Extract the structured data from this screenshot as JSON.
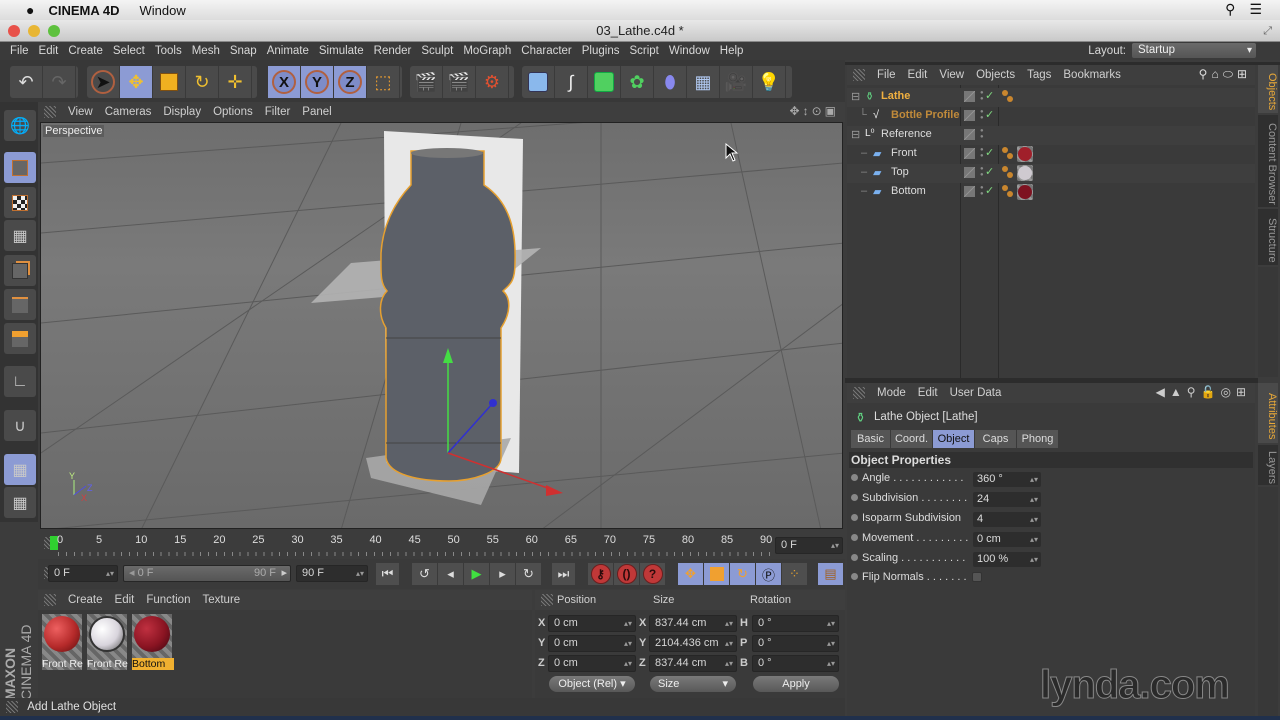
{
  "os_menubar": {
    "app_name": "CINEMA 4D",
    "menu": "Window",
    "apple_icon": "apple-icon",
    "search_icon": "search-icon",
    "list_icon": "list-icon"
  },
  "window": {
    "title": "03_Lathe.c4d *"
  },
  "menu": [
    "File",
    "Edit",
    "Create",
    "Select",
    "Tools",
    "Mesh",
    "Snap",
    "Animate",
    "Simulate",
    "Render",
    "Sculpt",
    "MoGraph",
    "Character",
    "Plugins",
    "Script",
    "Window",
    "Help"
  ],
  "layout": {
    "label": "Layout:",
    "value": "Startup"
  },
  "toolbar": {
    "undo": "undo-icon",
    "redo": "redo-icon",
    "tools": [
      "live-selection",
      "move",
      "scale",
      "rotate",
      "recent-tool"
    ],
    "axes": [
      "X",
      "Y",
      "Z"
    ],
    "coord_system": "world-coordinates",
    "render": [
      "render-view",
      "render-picture-viewer",
      "edit-render-settings"
    ],
    "create": [
      "cube",
      "pen-spline",
      "subdivision-surface",
      "array",
      "deformer",
      "floor",
      "camera",
      "light"
    ]
  },
  "viewport_menu": [
    "View",
    "Cameras",
    "Display",
    "Options",
    "Filter",
    "Panel"
  ],
  "viewport": {
    "label": "Perspective",
    "axis_x": "X",
    "axis_y": "Y",
    "axis_z": "Z"
  },
  "timeline": {
    "ticks": [
      "0",
      "5",
      "10",
      "15",
      "20",
      "25",
      "30",
      "35",
      "40",
      "45",
      "50",
      "55",
      "60",
      "65",
      "70",
      "75",
      "80",
      "85",
      "90"
    ],
    "current_frame": "0 F",
    "start": "0 F",
    "range_start": "0 F",
    "range_end": "90 F",
    "end": "90 F"
  },
  "material_menu": [
    "Create",
    "Edit",
    "Function",
    "Texture"
  ],
  "materials": [
    {
      "name": "Front Re",
      "color": "#b52a2a",
      "selected": false
    },
    {
      "name": "Front Re",
      "color": "#d8d4dc",
      "selected": false
    },
    {
      "name": "Bottom",
      "color": "#8a1422",
      "selected": true
    }
  ],
  "branding": {
    "maxon": "MAXON",
    "c4d": "CINEMA 4D",
    "lynda": "lynda.com"
  },
  "coordinates": {
    "headers": [
      "Position",
      "Size",
      "Rotation"
    ],
    "rows": [
      {
        "pos_label": "X",
        "pos": "0 cm",
        "size_label": "X",
        "size": "837.44 cm",
        "rot_label": "H",
        "rot": "0 °"
      },
      {
        "pos_label": "Y",
        "pos": "0 cm",
        "size_label": "Y",
        "size": "2104.436 cm",
        "rot_label": "P",
        "rot": "0 °"
      },
      {
        "pos_label": "Z",
        "pos": "0 cm",
        "size_label": "Z",
        "size": "837.44 cm",
        "rot_label": "B",
        "rot": "0 °"
      }
    ],
    "mode": "Object (Rel)",
    "size_mode": "Size",
    "apply": "Apply"
  },
  "status": "Add Lathe Object",
  "object_manager": {
    "menu": [
      "File",
      "Edit",
      "View",
      "Objects",
      "Tags",
      "Bookmarks"
    ],
    "objects": [
      {
        "name": "Lathe",
        "icon": "lathe-icon",
        "level": 0,
        "color": "#f0b040",
        "check": true,
        "tag": true,
        "material": null
      },
      {
        "name": "Bottle Profile",
        "icon": "spline-icon",
        "level": 1,
        "color": "#c08a3a",
        "check": true,
        "tag": false,
        "material": null
      },
      {
        "name": "Reference",
        "icon": "null-icon",
        "level": 0,
        "color": "#dddddd",
        "check": false,
        "tag": false,
        "material": null
      },
      {
        "name": "Front",
        "icon": "plane-icon",
        "level": 1,
        "color": "#dddddd",
        "check": true,
        "tag": true,
        "material": "#a01f2a"
      },
      {
        "name": "Top",
        "icon": "plane-icon",
        "level": 1,
        "color": "#dddddd",
        "check": true,
        "tag": true,
        "material": "#cfcad0"
      },
      {
        "name": "Bottom",
        "icon": "plane-icon",
        "level": 1,
        "color": "#dddddd",
        "check": true,
        "tag": true,
        "material": "#7e1220"
      }
    ]
  },
  "side_tabs_top": [
    "Objects",
    "Content Browser",
    "Structure"
  ],
  "side_tabs_bottom": [
    "Attributes",
    "Layers"
  ],
  "attributes": {
    "menu": [
      "Mode",
      "Edit",
      "User Data"
    ],
    "title": "Lathe Object [Lathe]",
    "tabs": [
      "Basic",
      "Coord.",
      "Object",
      "Caps",
      "Phong"
    ],
    "active_tab": "Object",
    "section": "Object Properties",
    "properties": [
      {
        "label": "Angle . . . . . . . . . . . .",
        "value": "360 °"
      },
      {
        "label": "Subdivision . . . . . . . .",
        "value": "24"
      },
      {
        "label": "Isoparm Subdivision",
        "value": "4"
      },
      {
        "label": "Movement . . . . . . . . .",
        "value": "0 cm"
      },
      {
        "label": "Scaling . . . . . . . . . . .",
        "value": "100 %"
      }
    ],
    "flip_normals_label": "Flip Normals . . . . . . .",
    "flip_normals": false
  }
}
